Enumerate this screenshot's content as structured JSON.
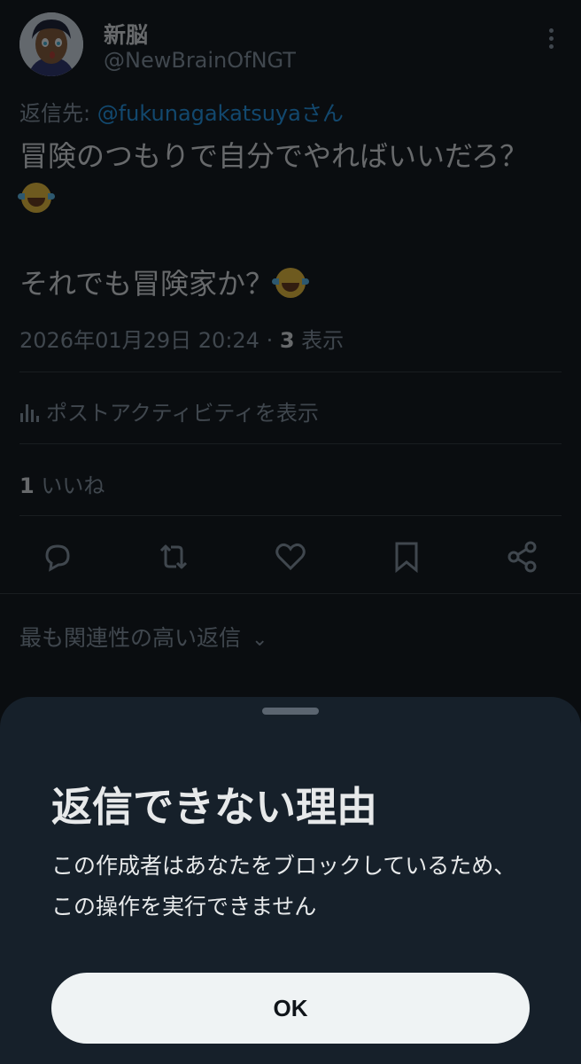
{
  "post": {
    "author": {
      "display_name": "新脳",
      "handle": "@NewBrainOfNGT"
    },
    "reply_to": {
      "prefix": "返信先: ",
      "mention": "@fukunagakatsuya",
      "suffix": "さん"
    },
    "body": {
      "line1": "冒険のつもりで自分でやればいいだろ？",
      "line3": "それでも冒険家か？"
    },
    "timestamp": "2026年01月29日 20:24 · ",
    "view_count": "3",
    "view_label": " 表示",
    "activity_label": "ポストアクティビティを表示",
    "like_count": "1",
    "like_label": " いいね",
    "sort_label": "最も関連性の高い返信",
    "colors": {
      "text": "#e7e9ea",
      "muted": "#8b98a5",
      "link": "#1d9bf0",
      "background": "#0a0d10"
    }
  },
  "icons": {
    "more": "more-vertical-icon",
    "activity": "bar-chart-icon",
    "reply": "reply-icon",
    "repost": "repost-icon",
    "like": "heart-icon",
    "bookmark": "bookmark-icon",
    "share": "share-icon",
    "sort": "chevron-down-icon",
    "emoji": "tears-of-joy-emoji"
  },
  "dialog": {
    "title": "返信できない理由",
    "message": "この作成者はあなたをブロックしているため、この操作を実行できません",
    "ok_label": "OK",
    "colors": {
      "sheet": "#16202a",
      "button": "#eff3f4",
      "button_text": "#0f1419"
    }
  }
}
